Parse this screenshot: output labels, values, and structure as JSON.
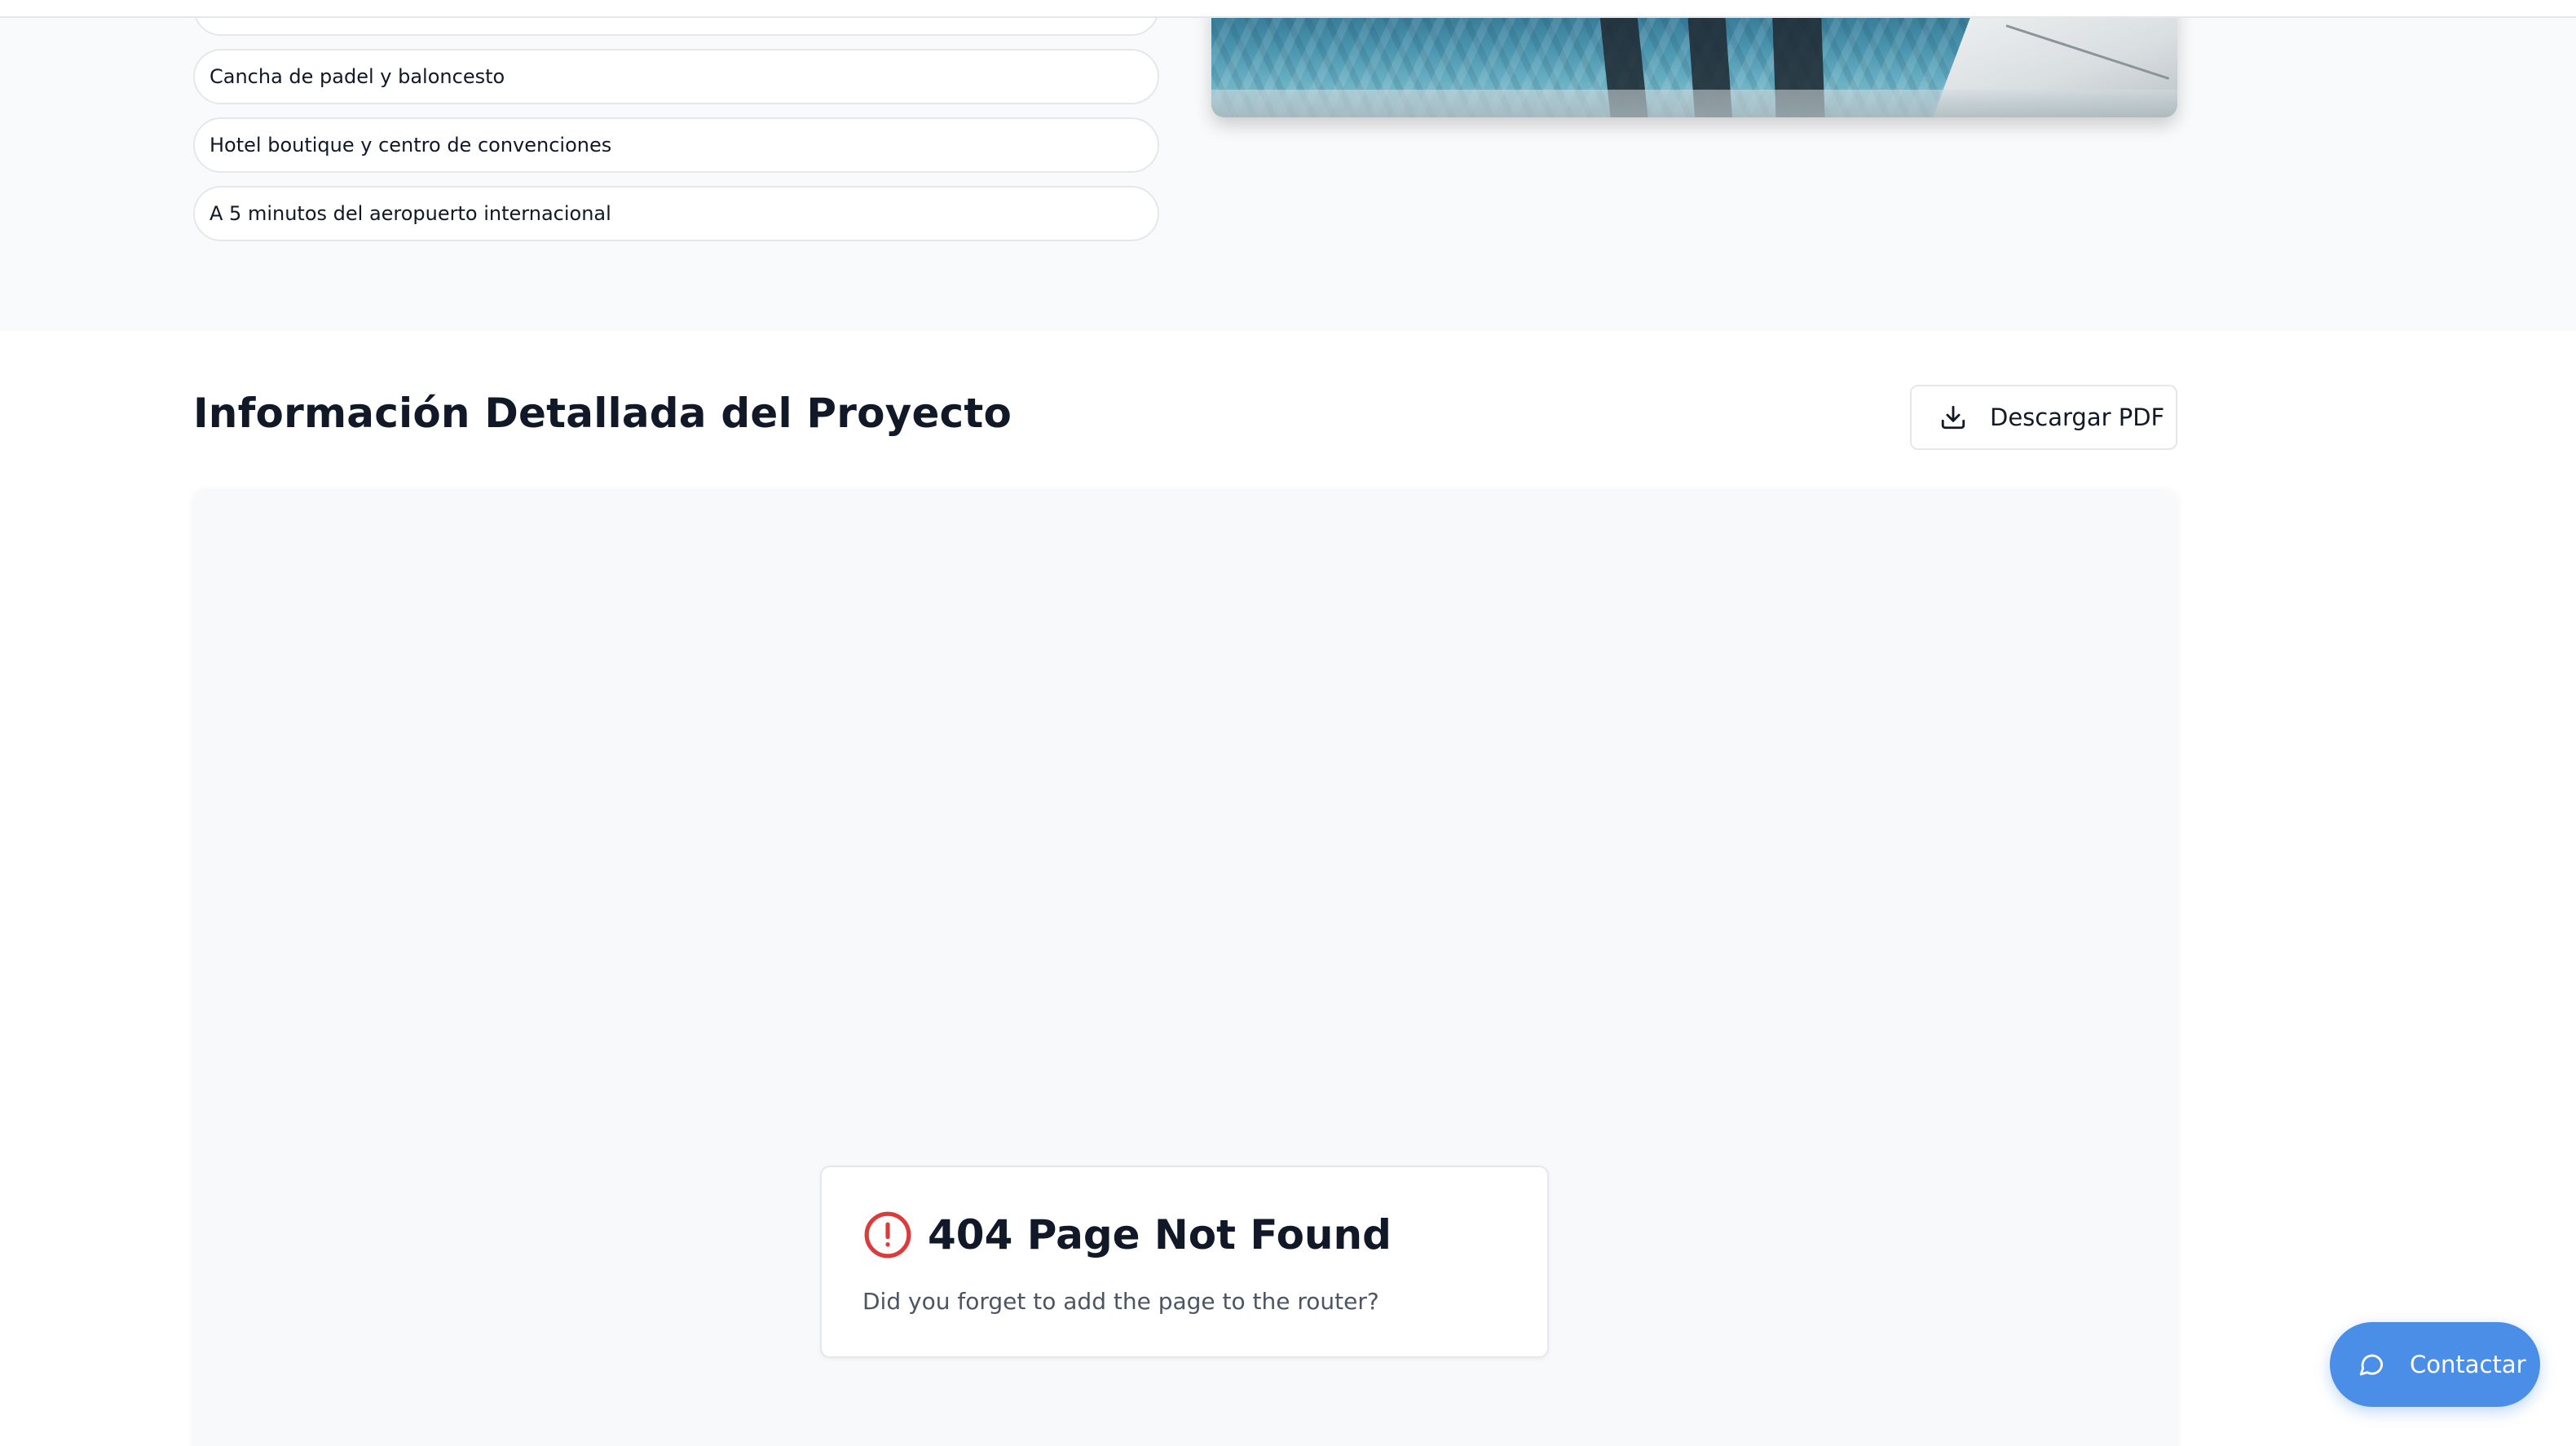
{
  "amenities": {
    "items": [
      "Cancha de padel y baloncesto",
      "Hotel boutique y centro de convenciones",
      "A 5 minutos del aeropuerto internacional"
    ]
  },
  "details": {
    "title": "Información Detallada del Proyecto",
    "download_label": "Descargar PDF",
    "download_icon": "download-icon"
  },
  "not_found": {
    "title": "404 Page Not Found",
    "message": "Did you forget to add the page to the router?",
    "icon": "alert-circle-icon",
    "icon_color": "#dc3b3b"
  },
  "contact": {
    "label": "Contactar",
    "icon": "message-circle-icon",
    "color": "#4a8ee8"
  }
}
